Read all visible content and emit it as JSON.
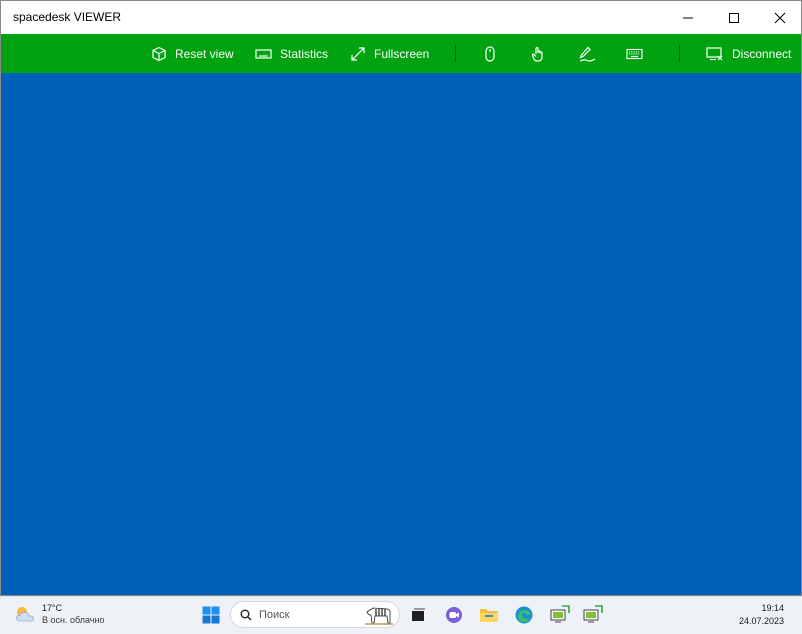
{
  "window": {
    "title": "spacedesk VIEWER"
  },
  "toolbar": {
    "reset_view": "Reset view",
    "statistics": "Statistics",
    "fullscreen": "Fullscreen",
    "disconnect": "Disconnect",
    "background": "#00a30f"
  },
  "viewport": {
    "background": "#005fb8"
  },
  "taskbar": {
    "weather_temp": "17°C",
    "weather_desc": "В осн. облачно",
    "search_placeholder": "Поиск",
    "time": "19:14",
    "date": "24.07.2023"
  },
  "icons": [
    "settings-cube-icon",
    "statistics-icon",
    "fullscreen-icon",
    "mouse-icon",
    "touch-icon",
    "pen-icon",
    "keyboard-icon",
    "disconnect-icon",
    "weather-icon",
    "windows-start-icon",
    "search-icon",
    "task-view-icon",
    "meet-icon",
    "file-explorer-icon",
    "edge-icon",
    "spacedesk-app-icon"
  ]
}
